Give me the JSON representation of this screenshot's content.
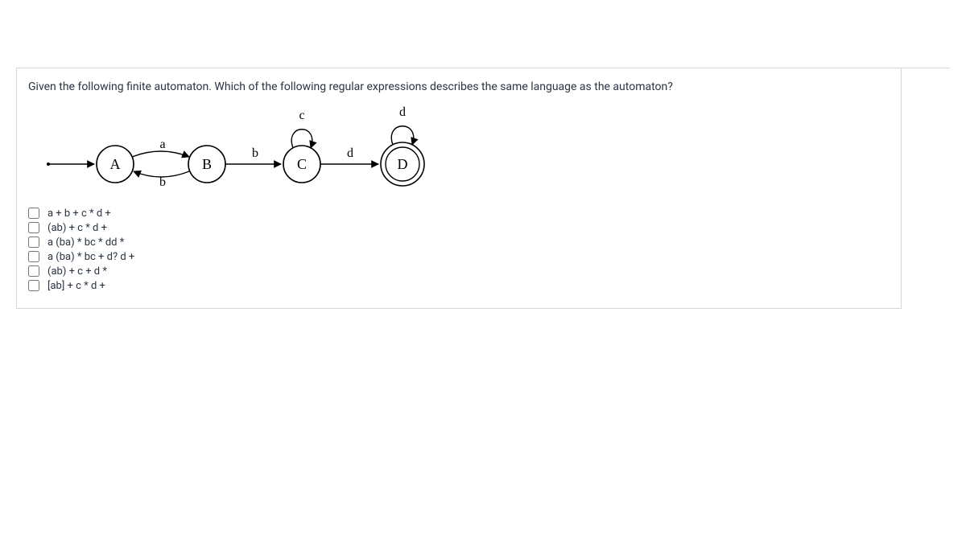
{
  "question": {
    "prompt": "Given the following finite automaton. Which of the following regular expressions describes the same language as the automaton?"
  },
  "automaton": {
    "states": [
      "A",
      "B",
      "C",
      "D"
    ],
    "edge_A_B": "a",
    "edge_B_A": "b",
    "edge_B_C": "b",
    "edge_C_D": "d",
    "loop_C": "c",
    "loop_D": "d"
  },
  "options": [
    {
      "label": "a + b + c * d +"
    },
    {
      "label": "(ab) + c * d +"
    },
    {
      "label": "a (ba) * bc * dd *"
    },
    {
      "label": "a (ba) * bc + d? d +"
    },
    {
      "label": "(ab) + c + d *"
    },
    {
      "label": "[ab] + c * d +"
    }
  ]
}
